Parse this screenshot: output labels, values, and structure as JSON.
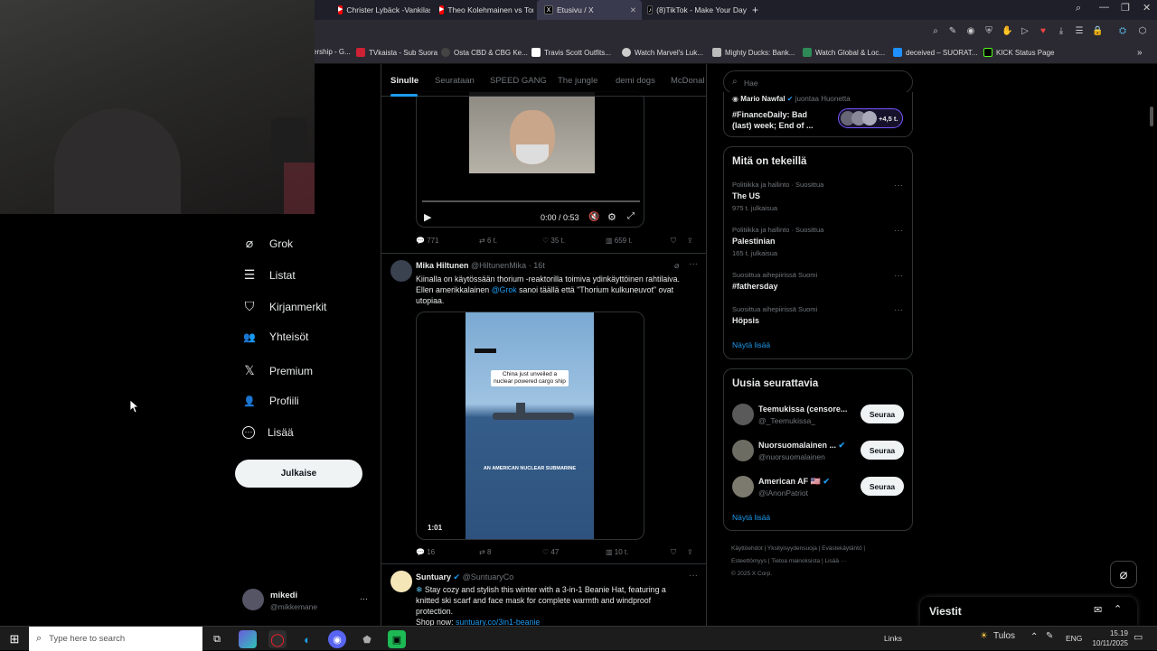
{
  "browser": {
    "tabs": [
      {
        "label": "Christer Lybäck -Vankilast",
        "icon": "youtube-icon",
        "color": "#ff0000"
      },
      {
        "label": "Theo Kolehmainen vs Tom",
        "icon": "youtube-icon",
        "color": "#ff0000"
      },
      {
        "label": "Etusivu / X",
        "icon": "x-icon",
        "color": "#000000",
        "active": true
      },
      {
        "label": "(8)TikTok - Make Your Day",
        "icon": "tiktok-icon",
        "color": "#000000"
      }
    ],
    "new_tab": "+",
    "bookmarks": [
      {
        "label": "ership - G...",
        "color": "#555555"
      },
      {
        "label": "TVkaista - Sub Suora",
        "color": "#cc2233"
      },
      {
        "label": "Osta CBD & CBG Ke...",
        "color": "#444444"
      },
      {
        "label": "Travis Scott Outfits...",
        "color": "#ffffff"
      },
      {
        "label": "Watch Marvel's Luk...",
        "color": "#cccccc"
      },
      {
        "label": "Mighty Ducks: Bank...",
        "color": "#cccccc"
      },
      {
        "label": "Watch Global & Loc...",
        "color": "#2e8b57"
      },
      {
        "label": "deceived – SUORAT...",
        "color": "#1e90ff"
      },
      {
        "label": "KICK Status Page",
        "color": "#000000"
      }
    ]
  },
  "sidebar": {
    "items": [
      {
        "label": "Grok",
        "icon": "grok-icon",
        "glyph": "⌀"
      },
      {
        "label": "Listat",
        "icon": "list-icon",
        "glyph": "☰"
      },
      {
        "label": "Kirjanmerkit",
        "icon": "bookmark-icon",
        "glyph": "⛉"
      },
      {
        "label": "Yhteisöt",
        "icon": "communities-icon",
        "glyph": "👥"
      },
      {
        "label": "Premium",
        "icon": "x-premium-icon",
        "glyph": "𝕏"
      },
      {
        "label": "Profiili",
        "icon": "profile-icon",
        "glyph": "👤"
      },
      {
        "label": "Lisää",
        "icon": "more-icon",
        "glyph": "⋯"
      }
    ],
    "post_button": "Julkaise",
    "account": {
      "name": "mikedi",
      "handle": "@mikkemane",
      "more": "···"
    }
  },
  "feed": {
    "tabs": [
      "Sinulle",
      "Seurataan",
      "SPEED GANG",
      "The jungle",
      "demi dogs",
      "McDonal"
    ],
    "video1": {
      "time": "0:00 / 0:53",
      "progress": 0,
      "actions": {
        "replies": "771",
        "reposts": "6 t.",
        "likes": "35 t.",
        "views": "659 t."
      }
    },
    "post2": {
      "name": "Mika Hiltunen",
      "handle": "@HiltunenMika · 16t",
      "text_1": "Kiinalla on käytössään thorium -reaktorilla toimiva ydinkäyttöinen rahtilaiva.",
      "text_2_pre": "Ellen amerikkalainen ",
      "text_2_link": "@Grok",
      "text_2_post": " sanoi täällä että \"Thorium kulkuneuvot\" ovat",
      "text_3": "utopiaa.",
      "video_caption": "China just unveiled a nuclear powered cargo ship",
      "video_subtitle": "AN AMERICAN NUCLEAR SUBMARINE",
      "duration": "1:01",
      "actions": {
        "replies": "16",
        "reposts": "8",
        "likes": "47",
        "views": "10 t."
      }
    },
    "post3": {
      "name": "Suntuary",
      "handle": "@SuntuaryCo",
      "text_1": "Stay cozy and stylish this winter with a 3-in-1 Beanie Hat, featuring a",
      "text_2": "knitted ski scarf and face mask for complete warmth and windproof",
      "text_3": "protection.",
      "text_4_pre": "Shop now: ",
      "text_4_link": "suntuary.co/3in1-beanie"
    }
  },
  "right": {
    "search_placeholder": "Hae",
    "spaces": {
      "host": "Mario Nawfal",
      "role": "juontaa Huonetta",
      "title_1": "#FinanceDaily: Bad",
      "title_2": "(last) week; End of ...",
      "count": "+4,5 t."
    },
    "trends": {
      "heading": "Mitä on tekeillä",
      "items": [
        {
          "meta": "Politiikka ja hallinto · Suosittua",
          "title": "The US",
          "count": "975 t. julkaisua"
        },
        {
          "meta": "Politiikka ja hallinto · Suosittua",
          "title": "Palestinian",
          "count": "165 t. julkaisua"
        },
        {
          "meta": "Suosittua aihepiirissä Suomi",
          "title": "#fathersday",
          "count": ""
        },
        {
          "meta": "Suosittua aihepiirissä Suomi",
          "title": "Höpsis",
          "count": ""
        }
      ],
      "show_more": "Näytä lisää"
    },
    "who_to_follow": {
      "heading": "Uusia seurattavia",
      "items": [
        {
          "name": "Teemukissa (censore...",
          "handle": "@_Teemukissa_",
          "verified": false,
          "button": "Seuraa"
        },
        {
          "name": "Nuorsuomalainen ...",
          "handle": "@nuorsuomalainen",
          "verified": true,
          "button": "Seuraa"
        },
        {
          "name": "American AF 🇺🇸",
          "handle": "@iAnonPatriot",
          "verified": true,
          "button": "Seuraa"
        }
      ],
      "show_more": "Näytä lisää"
    },
    "footer": {
      "links": [
        "Käyttöehdot",
        "Yksityisyydensuoja",
        "Evästekäytäntö",
        "Esteettömyys",
        "Tietoa mainoksista",
        "Lisää ···"
      ],
      "copyright": "© 2025 X Corp."
    },
    "messages": {
      "label": "Viestit"
    }
  },
  "taskbar": {
    "search_placeholder": "Type here to search",
    "links": "Links",
    "weather": "Tulos",
    "lang": "ENG",
    "time": "15.19",
    "date": "10/11/2025"
  }
}
